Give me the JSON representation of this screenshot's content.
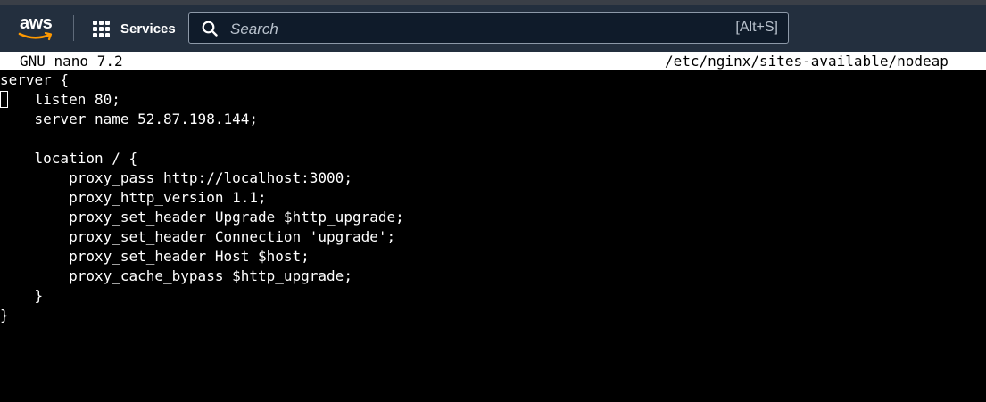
{
  "aws_header": {
    "logo_text": "aws",
    "services_label": "Services",
    "search": {
      "placeholder": "Search",
      "value": "",
      "shortcut": "[Alt+S]"
    },
    "icons": [
      "aws-logo",
      "services-grid-icon",
      "search-icon"
    ],
    "colors": {
      "bar_bg": "#232f3e",
      "smile": "#ff9900"
    }
  },
  "nano": {
    "version": "GNU nano 7.2",
    "file_path": "/etc/nginx/sites-available/nodeap",
    "lines": [
      "server {",
      "    listen 80;",
      "    server_name 52.87.198.144;",
      "",
      "    location / {",
      "        proxy_pass http://localhost:3000;",
      "        proxy_http_version 1.1;",
      "        proxy_set_header Upgrade $http_upgrade;",
      "        proxy_set_header Connection 'upgrade';",
      "        proxy_set_header Host $host;",
      "        proxy_cache_bypass $http_upgrade;",
      "    }",
      "}"
    ]
  }
}
